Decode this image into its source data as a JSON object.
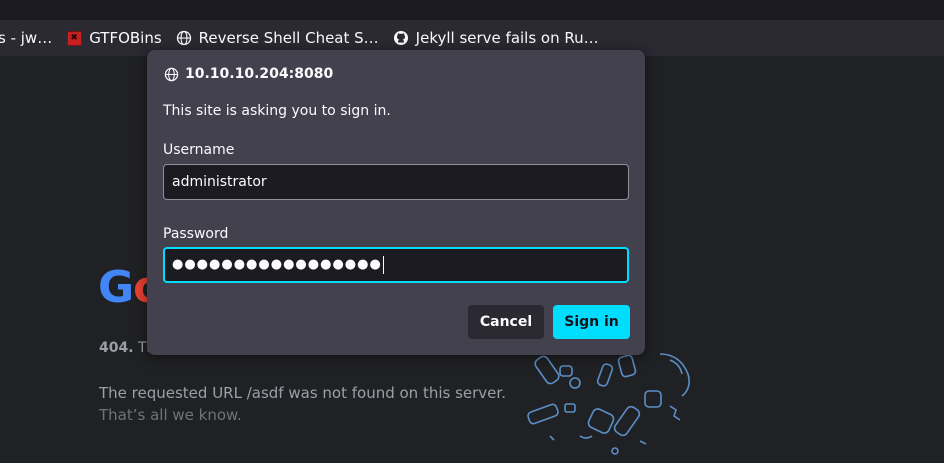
{
  "bookmarks": {
    "items": [
      {
        "label": "s - jw…",
        "icon": "none"
      },
      {
        "label": "GTFOBins",
        "icon": "gtfobins-icon"
      },
      {
        "label": "Reverse Shell Cheat S…",
        "icon": "globe-icon"
      },
      {
        "label": "Jekyll serve fails on Ru…",
        "icon": "github-icon"
      }
    ]
  },
  "page": {
    "logo_text_1": "G",
    "logo_text_2": "o",
    "error_code": "404.",
    "error_rest": "Th",
    "requested": "The requested URL /asdf was not found on this server.",
    "know": "That’s all we know."
  },
  "dialog": {
    "host": "10.10.10.204:8080",
    "message": "This site is asking you to sign in.",
    "username_label": "Username",
    "username_value": "administrator",
    "password_label": "Password",
    "password_value": "●●●●●●●●●●●●●●●●●",
    "cancel_label": "Cancel",
    "signin_label": "Sign in"
  },
  "colors": {
    "accent": "#00ddff",
    "dialog_bg": "#42414d",
    "page_bg": "#202124"
  }
}
